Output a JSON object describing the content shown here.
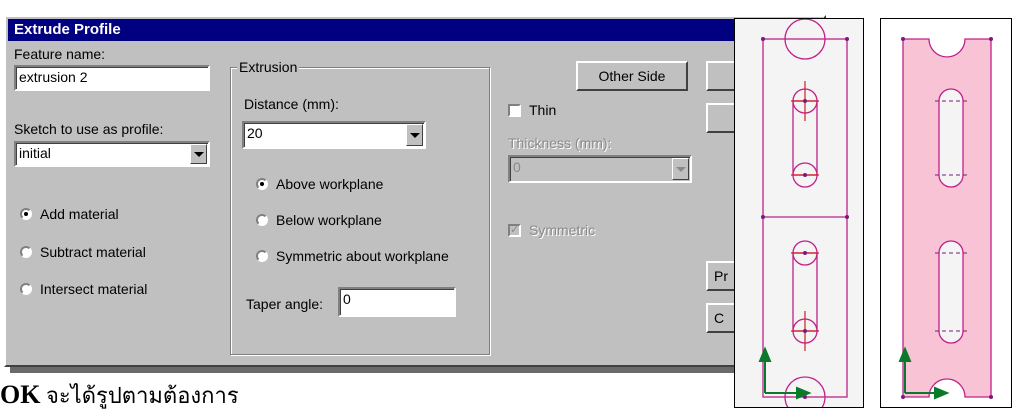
{
  "dialog": {
    "title": "Extrude Profile",
    "feature_name_label": "Feature name:",
    "feature_name_value": "extrusion 2",
    "sketch_label": "Sketch to use as profile:",
    "sketch_value": "initial",
    "material": {
      "options": [
        "Add material",
        "Subtract material",
        "Intersect material"
      ],
      "selected": "Add material"
    },
    "extrusion": {
      "group_title": "Extrusion",
      "distance_label": "Distance (mm):",
      "distance_value": "20",
      "workplane_options": [
        "Above workplane",
        "Below workplane",
        "Symmetric about workplane"
      ],
      "selected": "Above workplane",
      "taper_label": "Taper angle:",
      "taper_value": "0"
    },
    "other_side_label": "Other Side",
    "thin_label": "Thin",
    "thin_checked": false,
    "thickness_label": "Thickness (mm):",
    "thickness_value": "0",
    "symmetric_label": "Symmetric",
    "symmetric_checked": true,
    "button_partial_1": "Pr",
    "button_partial_2": "C"
  },
  "footer": {
    "bold": "OK",
    "text": " จะได้รูปตามต้องการ"
  },
  "colors": {
    "titlebar": "#000080",
    "sketch_line": "#c0208a",
    "axis": "#0a7a2a",
    "fill_pink": "#f9c3d6"
  },
  "icons": [
    "minimize-icon",
    "close-icon",
    "dropdown-arrow-icon",
    "axis-icon"
  ]
}
